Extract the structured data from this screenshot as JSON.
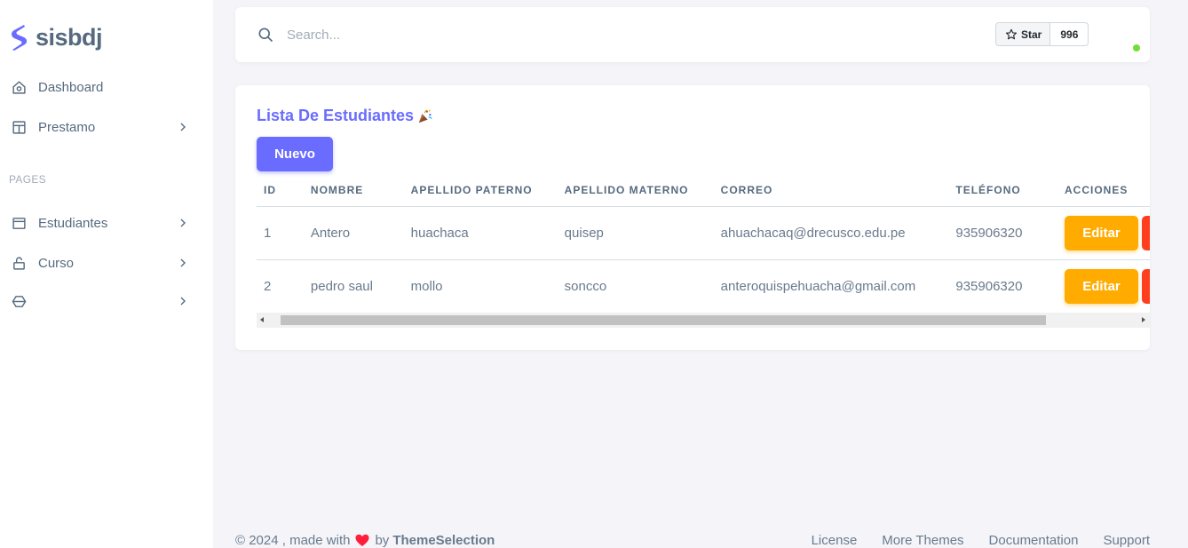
{
  "app": {
    "name": "sisbdj"
  },
  "sidebar": {
    "items": [
      {
        "label": "Dashboard",
        "icon": "home-icon"
      },
      {
        "label": "Prestamo",
        "icon": "layout-icon"
      }
    ],
    "section_header": "PAGES",
    "pages": [
      {
        "label": "Estudiantes",
        "icon": "window-icon"
      },
      {
        "label": "Curso",
        "icon": "lock-icon"
      },
      {
        "label": "",
        "icon": "cube-icon"
      }
    ]
  },
  "navbar": {
    "search_placeholder": "Search...",
    "star_label": "Star",
    "star_count": "996"
  },
  "card": {
    "title": "Lista De Estudiantes",
    "new_button": "Nuevo",
    "columns": [
      "ID",
      "NOMBRE",
      "APELLIDO PATERNO",
      "APELLIDO MATERNO",
      "CORREO",
      "TELÉFONO",
      "ACCIONES"
    ],
    "rows": [
      {
        "id": "1",
        "nombre": "Antero",
        "paterno": "huachaca",
        "materno": "quisep",
        "correo": "ahuachacaq@drecusco.edu.pe",
        "telefono": "935906320"
      },
      {
        "id": "2",
        "nombre": "pedro saul",
        "paterno": "mollo",
        "materno": "soncco",
        "correo": "anteroquispehuacha@gmail.com",
        "telefono": "935906320"
      }
    ],
    "edit_label": "Editar"
  },
  "footer": {
    "copyright": "© 2024 , made with",
    "by": "by",
    "brand": "ThemeSelection",
    "links": [
      "License",
      "More Themes",
      "Documentation",
      "Support"
    ]
  },
  "colors": {
    "primary": "#696cff",
    "warning": "#ffab00",
    "danger": "#ff3e1d",
    "online": "#71dd37"
  }
}
